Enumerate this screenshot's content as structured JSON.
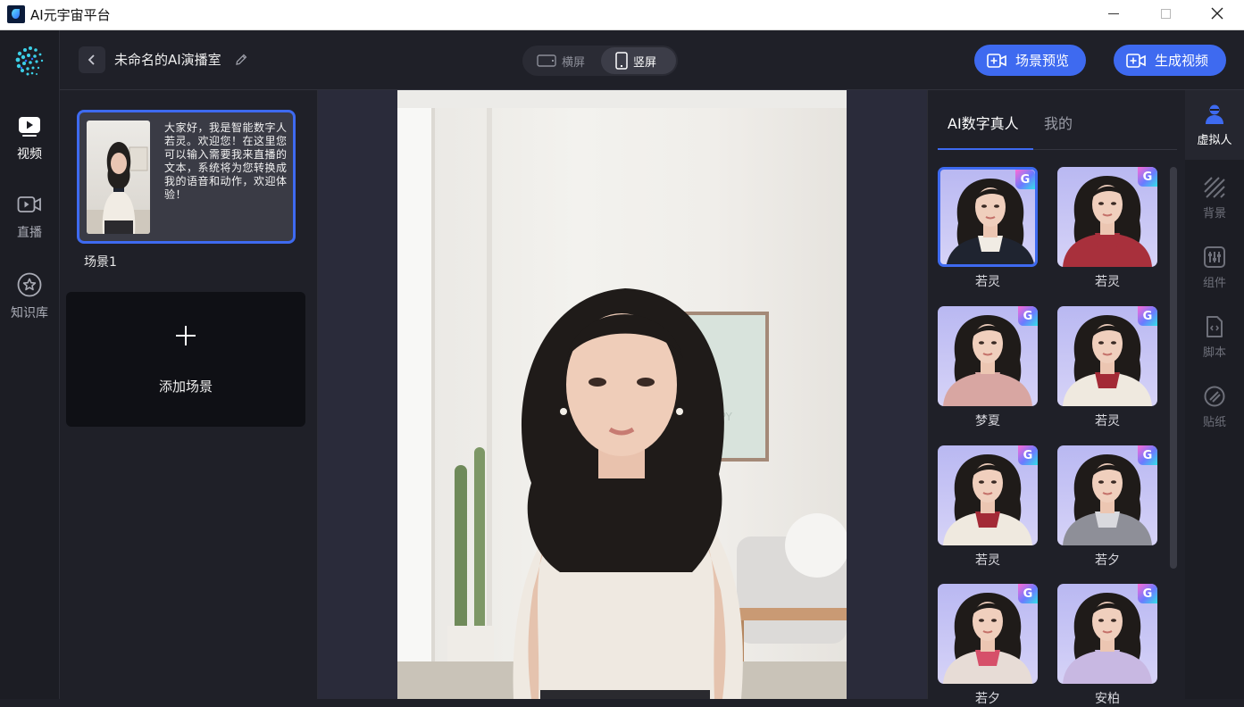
{
  "window": {
    "title": "AI元宇宙平台"
  },
  "left_nav": {
    "items": [
      {
        "label": "视频",
        "icon": "video-play-icon",
        "active": true
      },
      {
        "label": "直播",
        "icon": "live-camera-icon",
        "active": false
      },
      {
        "label": "知识库",
        "icon": "star-circle-icon",
        "active": false
      }
    ]
  },
  "topbar": {
    "project_title": "未命名的AI演播室",
    "orientation": {
      "landscape": "横屏",
      "portrait": "竖屏",
      "selected": "portrait"
    },
    "preview_button": "场景预览",
    "generate_button": "生成视频"
  },
  "scenes": {
    "items": [
      {
        "label": "场景1",
        "script": "大家好，我是智能数字人若灵。欢迎您！在这里您可以输入需要我来直播的文本，系统将为您转换成我的语音和动作，欢迎体验！"
      }
    ],
    "add_label": "添加场景"
  },
  "avatar_panel": {
    "tabs": [
      {
        "label": "AI数字真人",
        "active": true
      },
      {
        "label": "我的",
        "active": false
      }
    ],
    "badge": "G",
    "avatars": [
      {
        "name": "若灵",
        "outfit": "#1f2430",
        "top": "#f1ece4",
        "selected": true
      },
      {
        "name": "若灵",
        "outfit": "#a8303c",
        "top": "#a8303c",
        "selected": false
      },
      {
        "name": "梦夏",
        "outfit": "#d8a6a2",
        "top": "#d8a6a2",
        "selected": false
      },
      {
        "name": "若灵",
        "outfit": "#efe9df",
        "top": "#a32a36",
        "selected": false
      },
      {
        "name": "若灵",
        "outfit": "#efe9df",
        "top": "#a32a36",
        "selected": false
      },
      {
        "name": "若夕",
        "outfit": "#8e8f98",
        "top": "#d9d9de",
        "selected": false
      },
      {
        "name": "若夕",
        "outfit": "#e7dcd6",
        "top": "#d6506a",
        "selected": false
      },
      {
        "name": "安柏",
        "outfit": "#c8b8e2",
        "top": "#c8b8e2",
        "selected": false
      }
    ]
  },
  "right_tools": {
    "items": [
      {
        "label": "虚拟人",
        "icon": "avatar-person-icon",
        "active": true
      },
      {
        "label": "背景",
        "icon": "background-stripes-icon",
        "active": false
      },
      {
        "label": "组件",
        "icon": "sliders-icon",
        "active": false
      },
      {
        "label": "脚本",
        "icon": "script-file-icon",
        "active": false
      },
      {
        "label": "贴纸",
        "icon": "sticker-icon",
        "active": false
      }
    ]
  },
  "colors": {
    "accent": "#3e6af0",
    "background": "#1f2028",
    "sidebar": "#1c1d24"
  }
}
